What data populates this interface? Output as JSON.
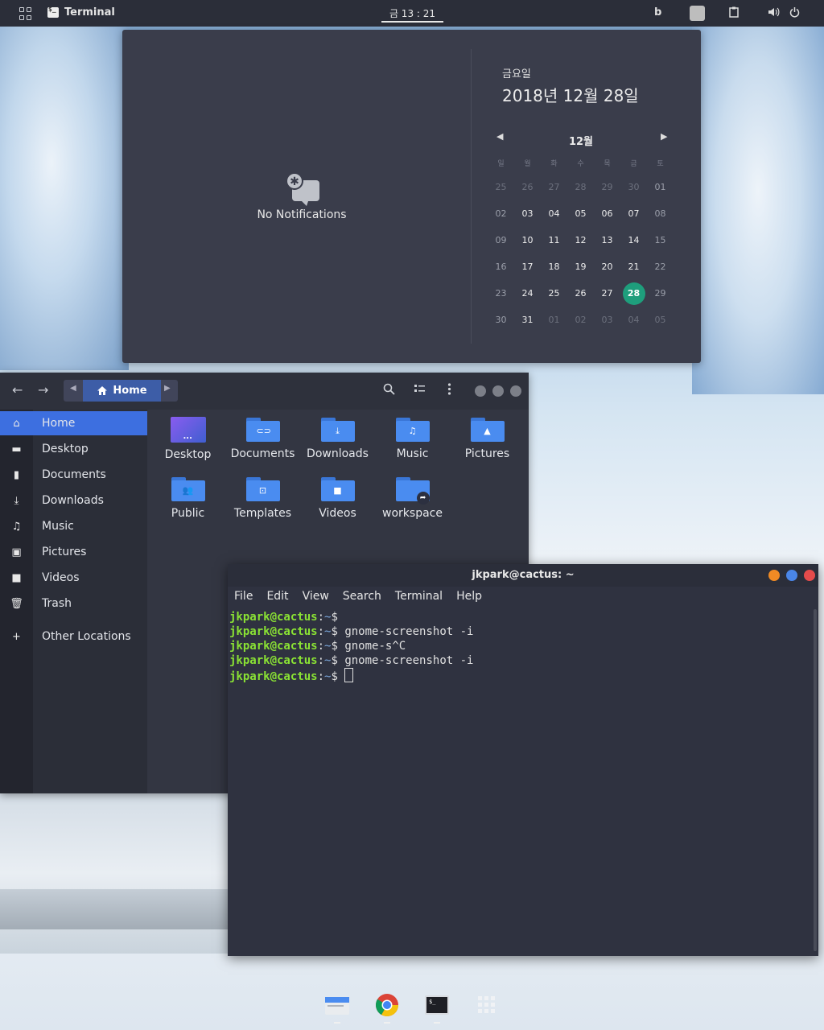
{
  "topbar": {
    "app_name": "Terminal",
    "clock": "금 13 : 21"
  },
  "calendar_popup": {
    "no_notifications": "No Notifications",
    "weekday": "금요일",
    "full_date": "2018년 12월 28일",
    "month": "12월",
    "prev_icon": "chevron-left-icon",
    "next_icon": "chevron-right-icon",
    "day_headers": [
      "일",
      "월",
      "화",
      "수",
      "목",
      "금",
      "토"
    ],
    "days": [
      [
        "25",
        "26",
        "27",
        "28",
        "29",
        "30",
        "01"
      ],
      [
        "02",
        "03",
        "04",
        "05",
        "06",
        "07",
        "08"
      ],
      [
        "09",
        "10",
        "11",
        "12",
        "13",
        "14",
        "15"
      ],
      [
        "16",
        "17",
        "18",
        "19",
        "20",
        "21",
        "22"
      ],
      [
        "23",
        "24",
        "25",
        "26",
        "27",
        "28",
        "29"
      ],
      [
        "30",
        "31",
        "01",
        "02",
        "03",
        "04",
        "05"
      ]
    ],
    "today": "28",
    "today_color": "#1e9e7c"
  },
  "files": {
    "path_home": "Home",
    "sidebar": [
      {
        "label": "Home",
        "icon": "home-icon"
      },
      {
        "label": "Desktop",
        "icon": "desktop-icon"
      },
      {
        "label": "Documents",
        "icon": "document-icon"
      },
      {
        "label": "Downloads",
        "icon": "download-icon"
      },
      {
        "label": "Music",
        "icon": "music-icon"
      },
      {
        "label": "Pictures",
        "icon": "picture-icon"
      },
      {
        "label": "Videos",
        "icon": "video-icon"
      },
      {
        "label": "Trash",
        "icon": "trash-icon"
      },
      {
        "label": "Other Locations",
        "icon": "plus-icon"
      }
    ],
    "items": [
      {
        "label": "Desktop"
      },
      {
        "label": "Documents"
      },
      {
        "label": "Downloads"
      },
      {
        "label": "Music"
      },
      {
        "label": "Pictures"
      },
      {
        "label": "Public"
      },
      {
        "label": "Templates"
      },
      {
        "label": "Videos"
      },
      {
        "label": "workspace"
      }
    ],
    "accent": "#3d6fe0"
  },
  "terminal": {
    "title": "jkpark@cactus: ~",
    "menu": [
      "File",
      "Edit",
      "View",
      "Search",
      "Terminal",
      "Help"
    ],
    "lines": [
      {
        "user": "jkpark@cactus",
        "path": "~",
        "cmd": ""
      },
      {
        "user": "jkpark@cactus",
        "path": "~",
        "cmd": " gnome-screenshot -i"
      },
      {
        "user": "jkpark@cactus",
        "path": "~",
        "cmd": " gnome-s^C"
      },
      {
        "user": "jkpark@cactus",
        "path": "~",
        "cmd": " gnome-screenshot -i"
      },
      {
        "user": "jkpark@cactus",
        "path": "~",
        "cmd": " "
      }
    ]
  },
  "dock": [
    "files-app-icon",
    "chrome-icon",
    "terminal-app-icon",
    "app-grid-icon"
  ]
}
